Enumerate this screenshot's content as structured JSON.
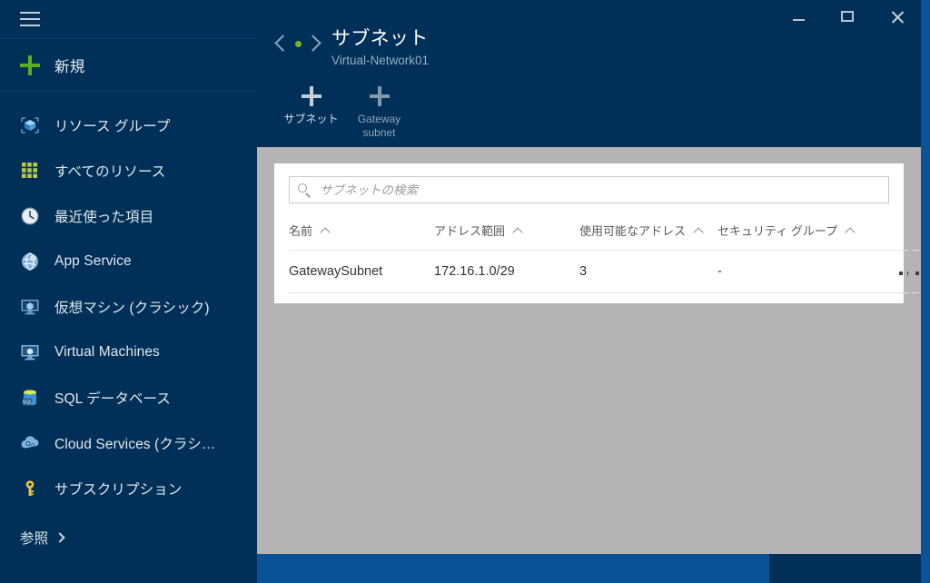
{
  "sidebar": {
    "hamburger_label": "menu",
    "new_label": "新規",
    "items": [
      {
        "label": "リソース グループ",
        "icon": "resource-group-icon"
      },
      {
        "label": "すべてのリソース",
        "icon": "all-resources-icon"
      },
      {
        "label": "最近使った項目",
        "icon": "recent-clock-icon"
      },
      {
        "label": "App Service",
        "icon": "app-service-icon"
      },
      {
        "label": "仮想マシン (クラシック)",
        "icon": "virtual-machine-classic-icon"
      },
      {
        "label": "Virtual Machines",
        "icon": "virtual-machines-icon"
      },
      {
        "label": "SQL データベース",
        "icon": "sql-database-icon"
      },
      {
        "label": "Cloud Services (クラシ…",
        "icon": "cloud-services-icon"
      },
      {
        "label": "サブスクリプション",
        "icon": "subscription-key-icon"
      }
    ],
    "browse_label": "参照"
  },
  "blade": {
    "icon": "subnet-icon",
    "title": "サブネット",
    "subtitle": "Virtual-Network01",
    "window_controls": {
      "minimize": "最小化",
      "maximize": "最大化",
      "close": "閉じる"
    },
    "toolbar": [
      {
        "label": "サブネット",
        "icon": "plus-icon",
        "state": "enabled"
      },
      {
        "label": "Gateway subnet",
        "icon": "plus-icon",
        "state": "dimmed"
      }
    ]
  },
  "search": {
    "placeholder": "サブネットの検索",
    "value": "",
    "icon": "search-icon"
  },
  "table": {
    "columns": [
      {
        "label": "名前",
        "sort": "asc"
      },
      {
        "label": "アドレス範囲",
        "sort": "asc"
      },
      {
        "label": "使用可能なアドレス",
        "sort": "asc"
      },
      {
        "label": "セキュリティ グループ",
        "sort": "asc"
      },
      {
        "label": ""
      }
    ],
    "rows": [
      {
        "name": "GatewaySubnet",
        "address_range": "172.16.1.0/29",
        "available_addresses": "3",
        "security_group": "-",
        "menu": "…"
      }
    ]
  },
  "colors": {
    "nav_background": "#003057",
    "blade_background": "#003057",
    "sheet_background": "#b4b4b4",
    "accent_green": "#5ab021",
    "accent_blue": "#0a5396",
    "card_background": "#ffffff"
  }
}
